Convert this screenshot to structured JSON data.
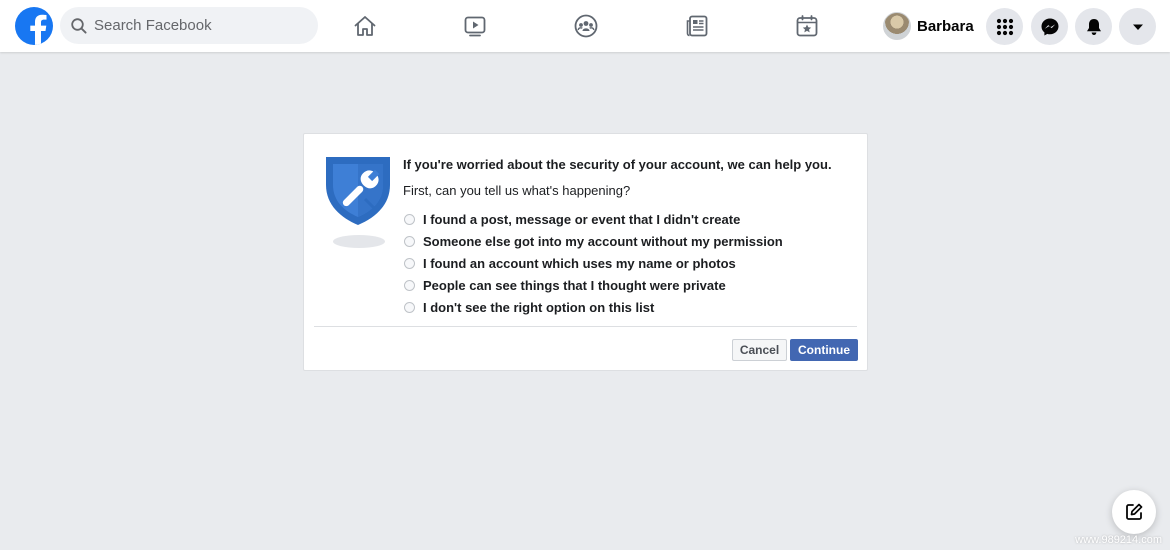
{
  "topbar": {
    "logo_icon": "facebook-logo-icon",
    "search": {
      "placeholder": "Search Facebook",
      "icon": "search-icon"
    },
    "nav_tabs": [
      {
        "name": "home",
        "icon": "home-icon"
      },
      {
        "name": "watch",
        "icon": "video-play-icon"
      },
      {
        "name": "groups",
        "icon": "groups-icon"
      },
      {
        "name": "news",
        "icon": "newspaper-icon"
      },
      {
        "name": "events",
        "icon": "calendar-star-icon"
      }
    ],
    "profile": {
      "name": "Barbara"
    },
    "actions": [
      {
        "name": "menu",
        "icon": "grid-menu-icon"
      },
      {
        "name": "messenger",
        "icon": "messenger-icon"
      },
      {
        "name": "notifications",
        "icon": "bell-icon"
      },
      {
        "name": "account",
        "icon": "caret-down-icon"
      }
    ]
  },
  "dialog": {
    "icon": "shield-wrench-icon",
    "title": "If you're worried about the security of your account, we can help you.",
    "question": "First, can you tell us what's happening?",
    "options": [
      "I found a post, message or event that I didn't create",
      "Someone else got into my account without my permission",
      "I found an account which uses my name or photos",
      "People can see things that I thought were private",
      "I don't see the right option on this list"
    ],
    "cancel_label": "Cancel",
    "continue_label": "Continue"
  },
  "compose_icon": "compose-icon",
  "watermark": "www.989214.com",
  "colors": {
    "brand_blue": "#1877f2",
    "button_blue": "#4267b2",
    "page_background": "#e9ebee",
    "shield_blue": "#2d6cc0"
  }
}
